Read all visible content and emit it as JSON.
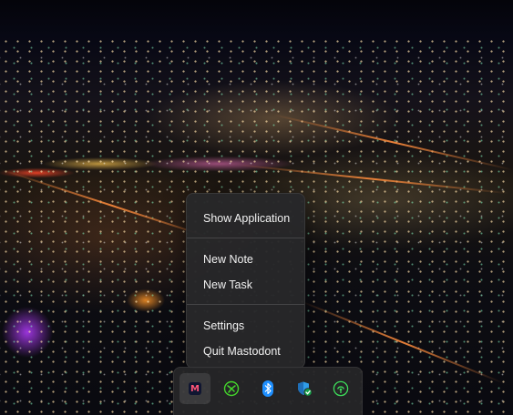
{
  "context_menu": {
    "items": [
      {
        "label": "Show Application"
      },
      {
        "label": "New Note"
      },
      {
        "label": "New Task"
      },
      {
        "label": "Settings"
      },
      {
        "label": "Quit Mastodont"
      }
    ]
  },
  "tray": {
    "icons": [
      {
        "name": "mastodont-app-icon",
        "glyph": "M",
        "color": "#ff5577",
        "active": true
      },
      {
        "name": "razer-icon",
        "color": "#44d62c"
      },
      {
        "name": "bluetooth-icon",
        "color": "#1e8fff"
      },
      {
        "name": "windows-security-icon",
        "color": "#2f9ce8"
      },
      {
        "name": "wireless-broadcast-icon",
        "color": "#3ddc5a"
      }
    ]
  }
}
